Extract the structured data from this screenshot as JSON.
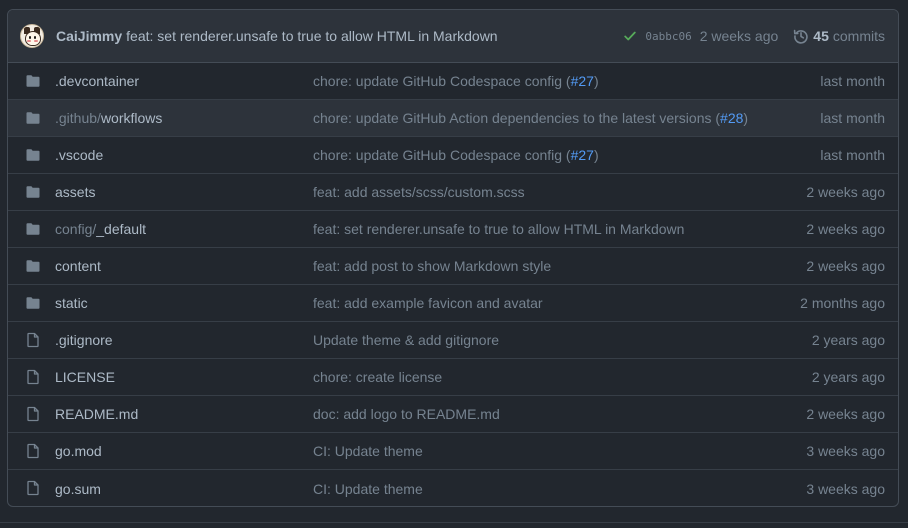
{
  "latest_commit": {
    "author": "CaiJimmy",
    "message": "feat: set renderer.unsafe to true to allow HTML in Markdown",
    "status_icon": "check-icon",
    "status_color": "#57ab5a",
    "sha": "0abbc06",
    "time": "2 weeks ago",
    "commit_count": "45",
    "commit_label": "commits"
  },
  "files": [
    {
      "type": "folder",
      "name_dim": "",
      "name": ".devcontainer",
      "msg": "chore: update GitHub Codespace config (",
      "pr": "#27",
      "msg_end": ")",
      "time": "last month"
    },
    {
      "type": "folder",
      "name_dim": ".github/",
      "name": "workflows",
      "msg": "chore: update GitHub Action dependencies to the latest versions (",
      "pr": "#28",
      "msg_end": ")",
      "time": "last month"
    },
    {
      "type": "folder",
      "name_dim": "",
      "name": ".vscode",
      "msg": "chore: update GitHub Codespace config (",
      "pr": "#27",
      "msg_end": ")",
      "time": "last month"
    },
    {
      "type": "folder",
      "name_dim": "",
      "name": "assets",
      "msg": "feat: add assets/scss/custom.scss",
      "pr": "",
      "msg_end": "",
      "time": "2 weeks ago"
    },
    {
      "type": "folder",
      "name_dim": "config/",
      "name": "_default",
      "msg": "feat: set renderer.unsafe to true to allow HTML in Markdown",
      "pr": "",
      "msg_end": "",
      "time": "2 weeks ago"
    },
    {
      "type": "folder",
      "name_dim": "",
      "name": "content",
      "msg": "feat: add post to show Markdown style",
      "pr": "",
      "msg_end": "",
      "time": "2 weeks ago"
    },
    {
      "type": "folder",
      "name_dim": "",
      "name": "static",
      "msg": "feat: add example favicon and avatar",
      "pr": "",
      "msg_end": "",
      "time": "2 months ago"
    },
    {
      "type": "file",
      "name_dim": "",
      "name": ".gitignore",
      "msg": "Update theme & add gitignore",
      "pr": "",
      "msg_end": "",
      "time": "2 years ago"
    },
    {
      "type": "file",
      "name_dim": "",
      "name": "LICENSE",
      "msg": "chore: create license",
      "pr": "",
      "msg_end": "",
      "time": "2 years ago"
    },
    {
      "type": "file",
      "name_dim": "",
      "name": "README.md",
      "msg": "doc: add logo to README.md",
      "pr": "",
      "msg_end": "",
      "time": "2 weeks ago"
    },
    {
      "type": "file",
      "name_dim": "",
      "name": "go.mod",
      "msg": "CI: Update theme",
      "pr": "",
      "msg_end": "",
      "time": "3 weeks ago"
    },
    {
      "type": "file",
      "name_dim": "",
      "name": "go.sum",
      "msg": "CI: Update theme",
      "pr": "",
      "msg_end": "",
      "time": "3 weeks ago"
    }
  ],
  "colors": {
    "background": "#22272e",
    "header_bg": "#2d333b",
    "border": "#444c56",
    "text": "#adbac7",
    "muted": "#768390",
    "link": "#539bf5",
    "folder_icon": "#768390"
  },
  "icons": {
    "folder": "folder-icon",
    "file": "file-icon",
    "history": "history-icon"
  }
}
